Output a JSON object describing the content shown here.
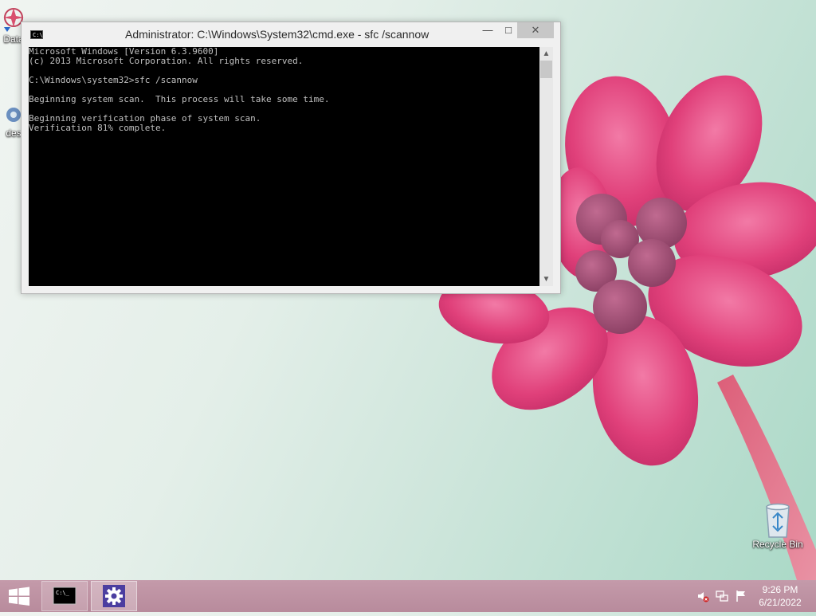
{
  "desktop": {
    "icons": [
      {
        "label": "Data"
      },
      {
        "label": "des"
      },
      {
        "label": "Recycle Bin"
      }
    ]
  },
  "cmd_window": {
    "title": "Administrator: C:\\Windows\\System32\\cmd.exe - sfc  /scannow",
    "icon_text": "C:\\",
    "controls": {
      "minimize": "—",
      "maximize": "□",
      "close": "✕"
    },
    "lines": [
      "Microsoft Windows [Version 6.3.9600]",
      "(c) 2013 Microsoft Corporation. All rights reserved.",
      "",
      "C:\\Windows\\system32>sfc /scannow",
      "",
      "Beginning system scan.  This process will take some time.",
      "",
      "Beginning verification phase of system scan.",
      "Verification 81% complete."
    ]
  },
  "taskbar": {
    "items": [
      {
        "name": "Command Prompt",
        "icon_text": "C:\\_"
      },
      {
        "name": "Settings",
        "icon": "gear-icon"
      }
    ],
    "tray": {
      "icons": [
        "speaker-muted-icon",
        "network-icon",
        "action-center-flag-icon"
      ]
    },
    "clock": {
      "time": "9:26 PM",
      "date": "6/21/2022"
    }
  },
  "colors": {
    "taskbar": "#b88b9c",
    "console_bg": "#000000",
    "console_text": "#c0c0c0",
    "flower": "#e0407a"
  }
}
